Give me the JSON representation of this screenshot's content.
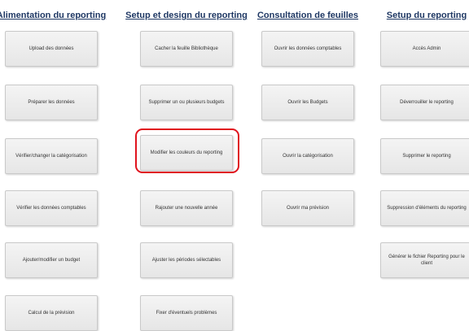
{
  "columns": [
    {
      "header": "Alimentation du reporting",
      "buttons": [
        "Upload des données",
        "Préparer les données",
        "Vérifier/changer la catégorisation",
        "Vérifier les données comptables",
        "Ajouter/modifier un budget",
        "Calcul de la prévision"
      ]
    },
    {
      "header": "Setup et design du reporting",
      "buttons": [
        "Cacher la feuille Bibliothèque",
        "Supprimer un ou plusieurs budgets",
        "Modifier les couleurs du reporting",
        "Rajouter une nouvelle année",
        "Ajuster les périodes sélectables",
        "Fixer d'éventuels problèmes"
      ]
    },
    {
      "header": "Consultation de feuilles",
      "buttons": [
        "Ouvrir les données comptables",
        "Ouvrir les Budgets",
        "Ouvrir la catégorisation",
        "Ouvrir ma prévision"
      ]
    },
    {
      "header": "Setup du reporting",
      "buttons": [
        "Accès Admin",
        "Déverrouiller le reporting",
        "Supprimer le reporting",
        "Suppression d'éléments du reporting",
        "Générer le fichier Reporting pour le client"
      ]
    }
  ],
  "highlight_color": "#e0141e",
  "header_color": "#1f3864"
}
